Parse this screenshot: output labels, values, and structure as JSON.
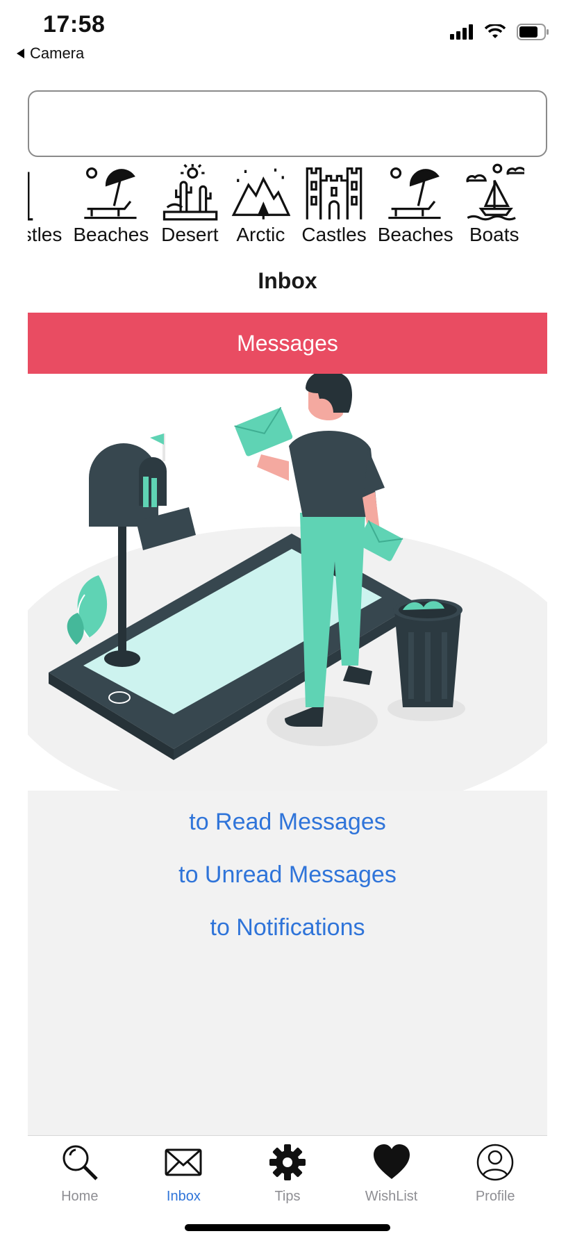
{
  "status_bar": {
    "time": "17:58",
    "back_label": "Camera",
    "icons": [
      "signal-icon",
      "wifi-icon",
      "battery-icon"
    ]
  },
  "search": {
    "value": "",
    "placeholder": ""
  },
  "categories": [
    {
      "label": "Castles",
      "icon": "castle-icon"
    },
    {
      "label": "Beaches",
      "icon": "beach-icon"
    },
    {
      "label": "Desert",
      "icon": "desert-icon"
    },
    {
      "label": "Arctic",
      "icon": "arctic-icon"
    },
    {
      "label": "Castles",
      "icon": "castle-icon"
    },
    {
      "label": "Beaches",
      "icon": "beach-icon"
    },
    {
      "label": "Boats",
      "icon": "boat-icon"
    }
  ],
  "page": {
    "title": "Inbox",
    "section_label": "Messages"
  },
  "links": [
    {
      "label": "to Read Messages"
    },
    {
      "label": "to Unread Messages"
    },
    {
      "label": "to Notifications"
    }
  ],
  "tabs": [
    {
      "label": "Home",
      "icon": "search-icon",
      "active": false
    },
    {
      "label": "Inbox",
      "icon": "envelope-icon",
      "active": true
    },
    {
      "label": "Tips",
      "icon": "gear-icon",
      "active": false
    },
    {
      "label": "WishList",
      "icon": "heart-icon",
      "active": false
    },
    {
      "label": "Profile",
      "icon": "person-icon",
      "active": false
    }
  ],
  "colors": {
    "accent": "#e94c62",
    "link": "#2f74d9",
    "panel_bg": "#f2f2f2",
    "illustration_teal": "#5fd3b4",
    "illustration_dark": "#37474f"
  }
}
